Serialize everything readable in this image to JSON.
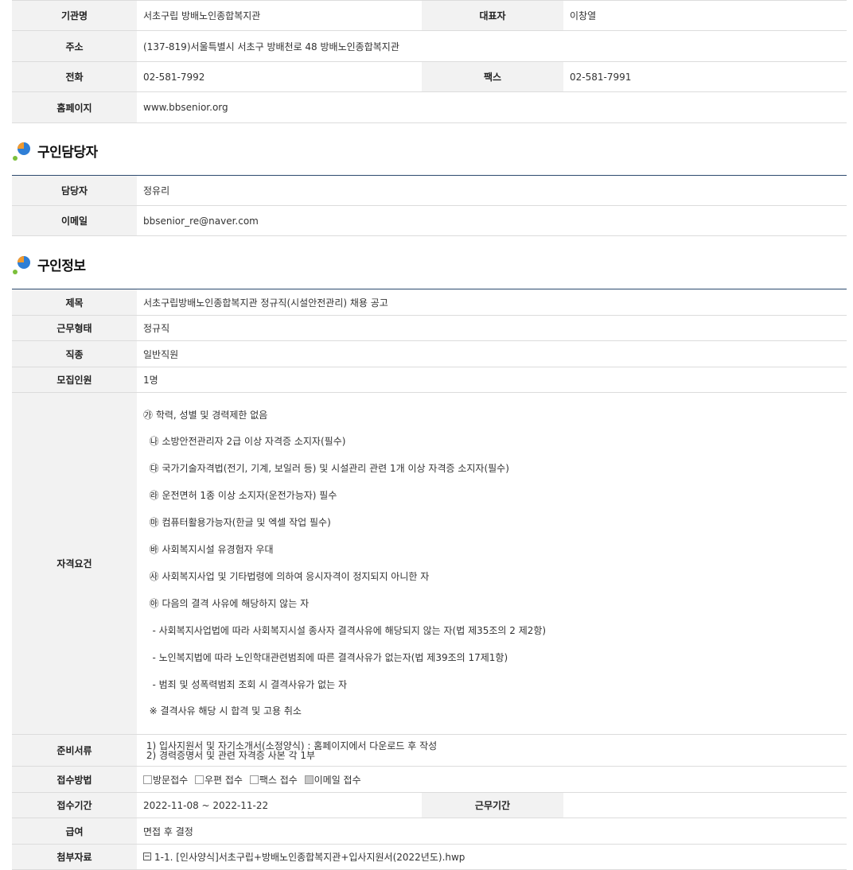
{
  "org": {
    "name_label": "기관명",
    "name": "서초구립 방배노인종합복지관",
    "rep_label": "대표자",
    "rep": "이창열",
    "address_label": "주소",
    "address": "(137-819)서울특별시 서초구 방배천로 48 방배노인종합복지관",
    "phone_label": "전화",
    "phone": "02-581-7992",
    "fax_label": "팩스",
    "fax": "02-581-7991",
    "homepage_label": "홈페이지",
    "homepage": "www.bbsenior.org"
  },
  "contact": {
    "title": "구인담당자",
    "person_label": "담당자",
    "person": "정유리",
    "email_label": "이메일",
    "email": "bbsenior_re@naver.com"
  },
  "job": {
    "title": "구인정보",
    "subject_label": "제목",
    "subject": "서초구립방배노인종합복지관 정규직(시설안전관리) 채용 공고",
    "type_label": "근무형태",
    "type": "정규직",
    "category_label": "직종",
    "category": "일반직원",
    "count_label": "모집인원",
    "count": "1명",
    "qual_label": "자격요건",
    "qualifications": [
      "㉮ 학력, 성별 및 경력제한 없음",
      "  ㉯ 소방안전관리자 2급 이상 자격증 소지자(필수)",
      "  ㉰ 국가기술자격법(전기, 기계, 보일러 등) 및 시설관리 관련 1개 이상 자격증 소지자(필수)",
      "  ㉱ 운전면허 1종 이상 소지자(운전가능자) 필수",
      "  ㉲ 컴퓨터활용가능자(한글 및 엑셀 작업 필수)",
      "  ㉳ 사회복지시설 유경험자 우대",
      "  ㉴ 사회복지사업 및 기타법령에 의하여 응시자격이 정지되지 아니한 자",
      "  ㉵ 다음의 결격 사유에 해당하지 않는 자",
      "   - 사회복지사업법에 따라 사회복지시설 종사자 결격사유에 해당되지 않는 자(법 제35조의 2 제2항)",
      "   - 노인복지법에 따라 노인학대관련범죄에 따른 결격사유가 없는자(법 제39조의 17제1항)",
      "   - 범죄 및 성폭력범죄 조회 시 결격사유가 없는 자",
      "  ※ 결격사유 해당 시 합격 및 고용 취소"
    ],
    "docs_label": "준비서류",
    "documents": [
      " 1) 입사지원서 및 자기소개서(소정양식) : 홈페이지에서 다운로드 후 작성",
      " 2) 경력증명서 및 관련 자격증 사본 각 1부"
    ],
    "method_label": "접수방법",
    "methods": [
      {
        "label": "방문접수",
        "checked": false
      },
      {
        "label": "우편 접수",
        "checked": false
      },
      {
        "label": "팩스 접수",
        "checked": false
      },
      {
        "label": "이메일 접수",
        "checked": true
      }
    ],
    "period_label": "접수기간",
    "period": "2022-11-08 ~ 2022-11-22",
    "work_period_label": "근무기간",
    "work_period": "",
    "salary_label": "급여",
    "salary": "면접 후 결정",
    "attach_label": "첨부자료",
    "attachment": "1-1. [인사양식]서초구립+방배노인종합복지관+입사지원서(2022년도).hwp"
  },
  "colors": {
    "header_bg": "#f2f2f2",
    "section_line": "#2c4a6e",
    "icon_blue": "#2f7fd6",
    "icon_orange": "#f29a2e",
    "icon_green": "#7bbf3a"
  }
}
